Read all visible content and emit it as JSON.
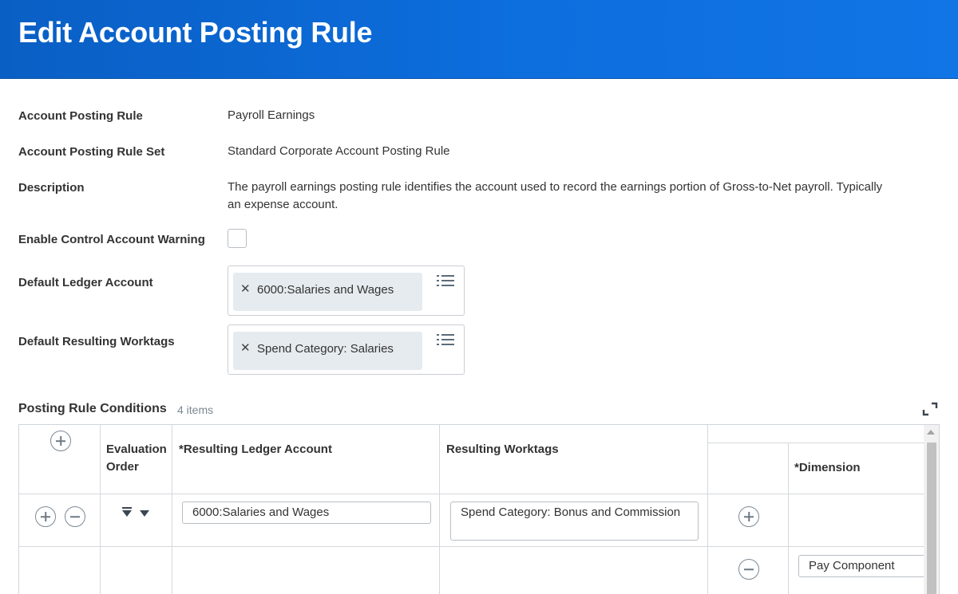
{
  "header": {
    "title": "Edit Account Posting Rule"
  },
  "fields": {
    "rule_label": "Account Posting Rule",
    "rule_value": "Payroll Earnings",
    "rule_set_label": "Account Posting Rule Set",
    "rule_set_value": "Standard Corporate Account Posting Rule",
    "description_label": "Description",
    "description_line1": "The payroll earnings posting rule identifies the account used to record the earnings portion of Gross-to-Net payroll. Typically",
    "description_line2": "an expense account.",
    "control_warning_label": "Enable Control Account Warning",
    "ledger_label": "Default Ledger Account",
    "ledger_pill": "6000:Salaries and Wages",
    "worktags_label": "Default Resulting Worktags",
    "worktags_pill": "Spend Category: Salaries"
  },
  "conditions": {
    "title": "Posting Rule Conditions",
    "count": "4 items",
    "headers": {
      "evaluation_order": "Evaluation Order",
      "resulting_ledger_account": "*Resulting Ledger Account",
      "resulting_worktags": "Resulting Worktags",
      "dimension": "*Dimension"
    },
    "rows": [
      {
        "ledger_account": "6000:Salaries and Wages",
        "worktags": "Spend Category: Bonus and Commission",
        "dimension": "Pay Component"
      }
    ]
  },
  "colors": {
    "header_blue": "#0d6ede",
    "pill_bg": "#e6ebef"
  },
  "icons": [
    "close-icon",
    "list-icon",
    "add-icon",
    "remove-icon",
    "sort-icon",
    "expand-icon"
  ]
}
